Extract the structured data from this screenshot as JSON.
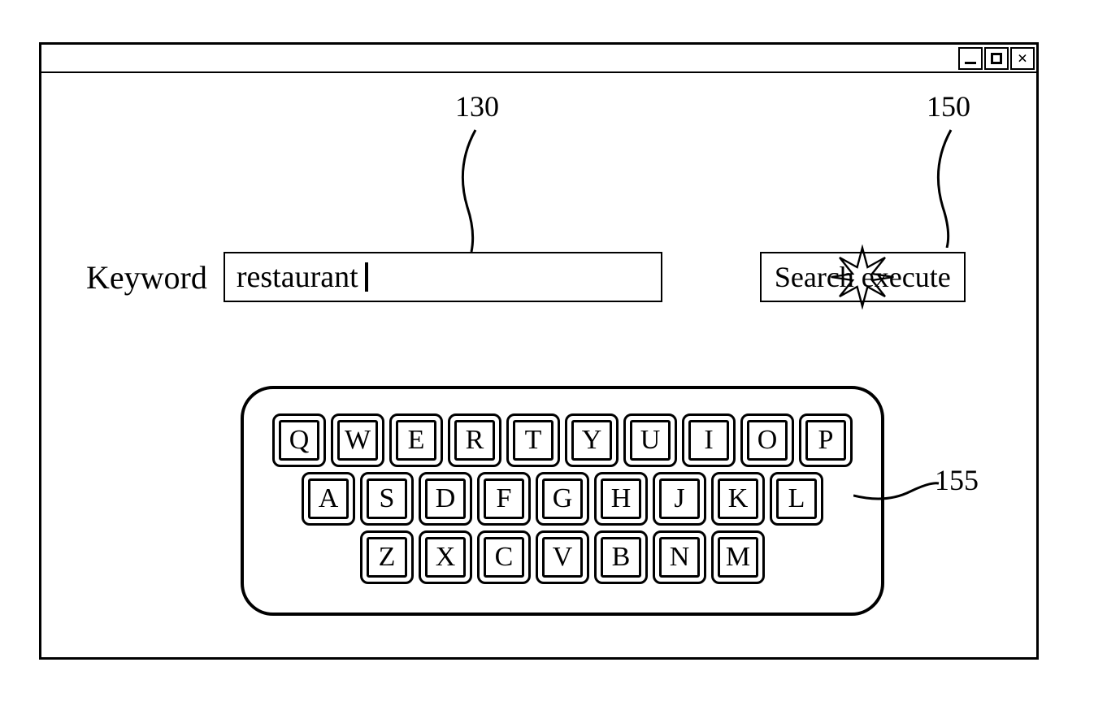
{
  "search": {
    "label": "Keyword",
    "value": "restaurant",
    "button_label": "Search execute"
  },
  "keyboard": {
    "rows": [
      [
        "Q",
        "W",
        "E",
        "R",
        "T",
        "Y",
        "U",
        "I",
        "O",
        "P"
      ],
      [
        "A",
        "S",
        "D",
        "F",
        "G",
        "H",
        "J",
        "K",
        "L"
      ],
      [
        "Z",
        "X",
        "C",
        "V",
        "B",
        "N",
        "M"
      ]
    ]
  },
  "callouts": {
    "input_ref": "130",
    "button_ref": "150",
    "keyboard_ref": "155"
  }
}
